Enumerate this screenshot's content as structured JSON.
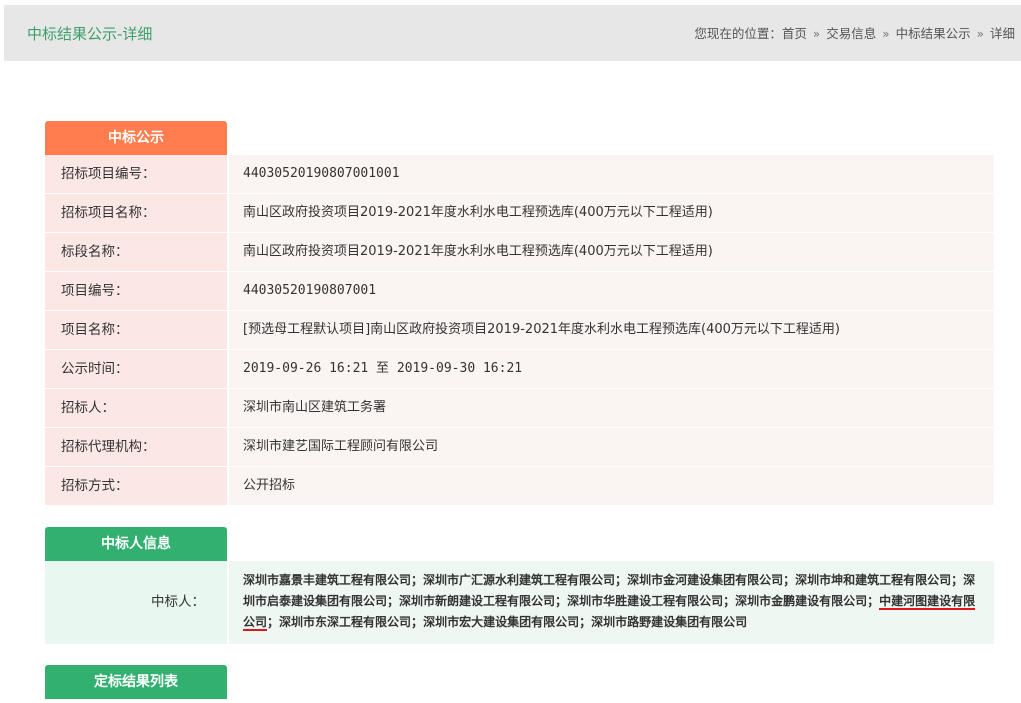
{
  "header": {
    "title": "中标结果公示-详细",
    "breadcrumb_prefix": "您现在的位置：",
    "crumbs": [
      "首页",
      "交易信息",
      "中标结果公示",
      "详细"
    ],
    "separator": "»"
  },
  "section_notice": {
    "tab_label": "中标公示",
    "rows": [
      {
        "label": "招标项目编号：",
        "value": "44030520190807001001"
      },
      {
        "label": "招标项目名称：",
        "value": "南山区政府投资项目2019-2021年度水利水电工程预选库(400万元以下工程适用)"
      },
      {
        "label": "标段名称：",
        "value": "南山区政府投资项目2019-2021年度水利水电工程预选库(400万元以下工程适用)"
      },
      {
        "label": "项目编号：",
        "value": "44030520190807001"
      },
      {
        "label": "项目名称：",
        "value": "[预选母工程默认项目]南山区政府投资项目2019-2021年度水利水电工程预选库(400万元以下工程适用)"
      },
      {
        "label": "公示时间：",
        "value": "2019-09-26 16:21 至 2019-09-30 16:21"
      },
      {
        "label": "招标人：",
        "value": "深圳市南山区建筑工务署"
      },
      {
        "label": "招标代理机构：",
        "value": "深圳市建艺国际工程顾问有限公司"
      },
      {
        "label": "招标方式：",
        "value": "公开招标"
      }
    ]
  },
  "section_winner": {
    "tab_label": "中标人信息",
    "label": "中标人：",
    "companies": [
      "深圳市嘉景丰建筑工程有限公司",
      "深圳市广汇源水利建筑工程有限公司",
      "深圳市金河建设集团有限公司",
      "深圳市坤和建筑工程有限公司",
      "深圳市启泰建设集团有限公司",
      "深圳市新朗建设工程有限公司",
      "深圳市华胜建设工程有限公司",
      "深圳市金鹏建设有限公司",
      "中建河图建设有限公司",
      "深圳市东深工程有限公司",
      "深圳市宏大建设集团有限公司",
      "深圳市路野建设集团有限公司"
    ],
    "company_separator": "；",
    "highlighted_company": "中建河图建设有限公司"
  },
  "section_results": {
    "tab_label": "定标结果列表"
  },
  "colors": {
    "accent_orange": "#ff7d4f",
    "accent_green": "#31b06f",
    "title_green": "#3f9f6a",
    "highlight_underline": "#e01818"
  }
}
